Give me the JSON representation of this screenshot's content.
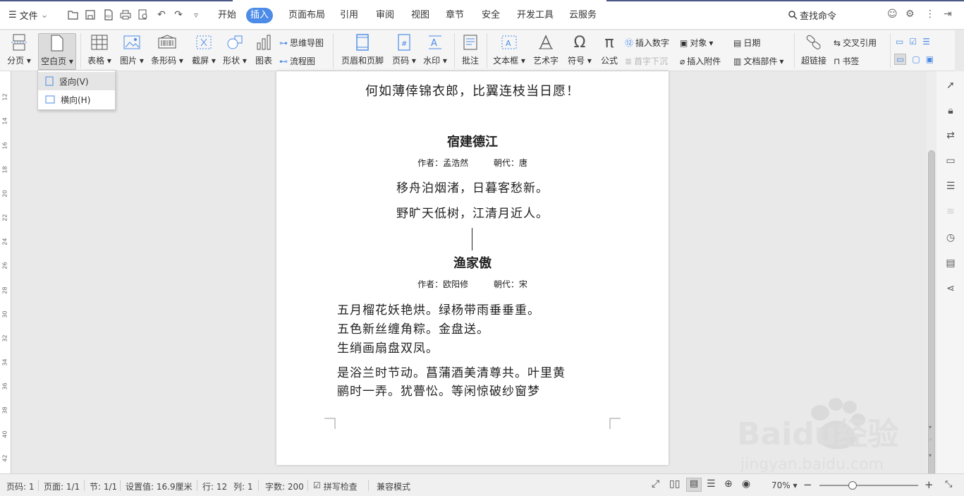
{
  "menubar": {
    "file_label": "文件",
    "tabs": [
      {
        "label": "开始",
        "active": false
      },
      {
        "label": "插入",
        "active": true
      },
      {
        "label": "页面布局",
        "active": false
      },
      {
        "label": "引用",
        "active": false
      },
      {
        "label": "审阅",
        "active": false
      },
      {
        "label": "视图",
        "active": false
      },
      {
        "label": "章节",
        "active": false
      },
      {
        "label": "安全",
        "active": false
      },
      {
        "label": "开发工具",
        "active": false
      },
      {
        "label": "云服务",
        "active": false
      }
    ],
    "search_label": "查找命令",
    "accent_color": "#4c8be8"
  },
  "ribbon": {
    "page_break": "分页",
    "blank_page": "空白页",
    "table": "表格",
    "picture": "图片",
    "barcode": "条形码",
    "screenshot": "截屏",
    "shape": "形状",
    "chart": "图表",
    "mindmap": "思维导图",
    "flowchart": "流程图",
    "header_footer": "页眉和页脚",
    "page_number": "页码",
    "watermark": "水印",
    "comment": "批注",
    "textbox": "文本框",
    "wordart": "艺术字",
    "symbol": "符号",
    "equation": "公式",
    "insert_number": "插入数字",
    "first_drop": "首字下沉",
    "object": "对象",
    "insert_attachment": "插入附件",
    "date": "日期",
    "doc_parts": "文档部件",
    "hyperlink": "超链接",
    "cross_reference": "交叉引用",
    "bookmark": "书签"
  },
  "dropdown": {
    "items": [
      {
        "label": "竖向(V)"
      },
      {
        "label": "横向(H)"
      }
    ]
  },
  "ruler": {
    "ticks": [
      "12",
      "14",
      "16",
      "18",
      "20",
      "22",
      "24",
      "26",
      "28",
      "30",
      "32",
      "34",
      "36",
      "38",
      "40",
      "42"
    ]
  },
  "document": {
    "line_top": "何如薄倖锦衣郎，比翼连枝当日愿！",
    "poem1": {
      "title": "宿建德江",
      "author": "作者：孟浩然",
      "dynasty": "朝代：唐",
      "lines": [
        "移舟泊烟渚，日暮客愁新。",
        "野旷天低树，江清月近人。"
      ]
    },
    "poem2": {
      "title": "渔家傲",
      "author": "作者：欧阳修",
      "dynasty": "朝代：宋",
      "lines": [
        "五月榴花妖艳烘。绿杨带雨垂垂重。",
        "五色新丝缠角粽。金盘送。",
        "生绡画扇盘双凤。",
        "是浴兰时节动。菖蒲酒美清尊共。叶里黄",
        "鹂时一弄。犹瞢忪。等闲惊破纱窗梦"
      ]
    }
  },
  "statusbar": {
    "page": "页码: 1",
    "pages": "页面: 1/1",
    "section": "节: 1/1",
    "setting": "设置值: 16.9厘米",
    "row": "行: 12",
    "col": "列: 1",
    "words": "字数: 200",
    "spellcheck": "拼写检查",
    "compat": "兼容模式",
    "zoom": "70%"
  },
  "watermark": {
    "brand": "Baidu经验",
    "url": "jingyan.baidu.com"
  }
}
